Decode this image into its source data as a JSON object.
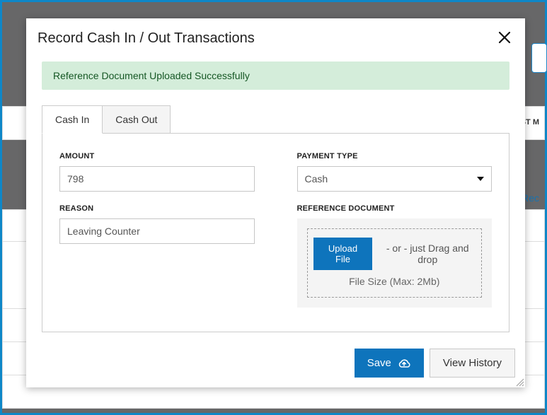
{
  "modal": {
    "title": "Record Cash In / Out Transactions",
    "alert": "Reference Document Uploaded Successfully",
    "tabs": {
      "cash_in": "Cash In",
      "cash_out": "Cash Out"
    },
    "form": {
      "amount_label": "AMOUNT",
      "amount_value": "798",
      "reason_label": "REASON",
      "reason_value": "Leaving Counter",
      "payment_type_label": "PAYMENT TYPE",
      "payment_type_value": "Cash",
      "ref_doc_label": "REFERENCE DOCUMENT",
      "upload_btn": "Upload File",
      "upload_hint": "- or - just Drag and drop",
      "upload_sub": "File Size (Max: 2Mb)"
    },
    "footer": {
      "save_label": "Save",
      "history_label": "View History"
    }
  },
  "background": {
    "col_header_suffix": "AST M",
    "link_fragment": "Rec"
  }
}
